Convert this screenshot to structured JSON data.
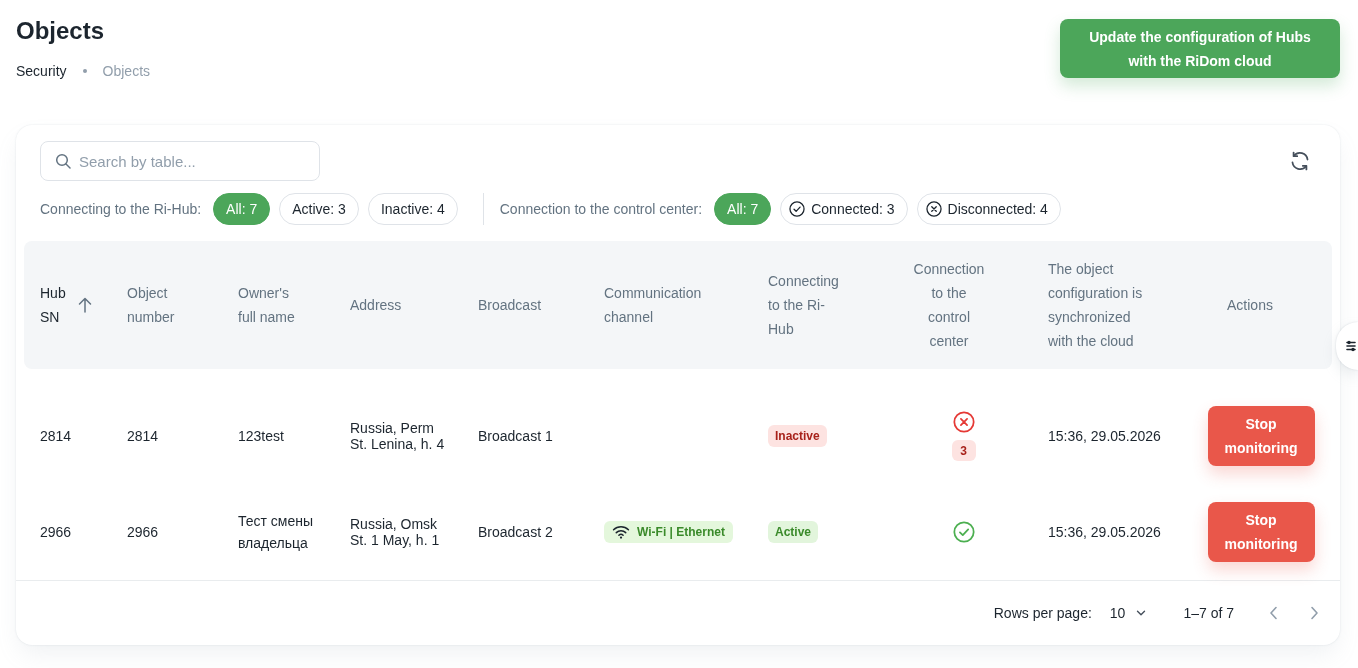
{
  "page": {
    "title": "Objects",
    "breadcrumbs": [
      {
        "label": "Security",
        "current": false
      },
      {
        "label": "Objects",
        "current": true
      }
    ],
    "update_button": "Update the configuration of Hubs with the RiDom cloud"
  },
  "search": {
    "placeholder": "Search by table..."
  },
  "filters": [
    {
      "label": "Connecting to the Ri-Hub:",
      "chips": [
        {
          "label": "All: 7",
          "kind": "all",
          "selected": true
        },
        {
          "label": "Active: 3",
          "kind": "active",
          "selected": false
        },
        {
          "label": "Inactive: 4",
          "kind": "inactive",
          "selected": false
        }
      ]
    },
    {
      "label": "Connection to the control center:",
      "chips": [
        {
          "label": "All: 7",
          "kind": "all",
          "selected": true
        },
        {
          "label": "Connected: 3",
          "kind": "connected",
          "selected": false
        },
        {
          "label": "Disconnected: 4",
          "kind": "disconnected",
          "selected": false
        }
      ]
    }
  ],
  "table": {
    "columns": [
      {
        "label": "Hub SN",
        "sorted": true
      },
      {
        "label": "Object number",
        "sorted": false
      },
      {
        "label": "Owner's full name",
        "sorted": false
      },
      {
        "label": "Address",
        "sorted": false
      },
      {
        "label": "Broadcast",
        "sorted": false
      },
      {
        "label": "Communication channel",
        "sorted": false
      },
      {
        "label": "Connecting to the Ri-Hub",
        "sorted": false
      },
      {
        "label": "Connection to the control center",
        "sorted": false
      },
      {
        "label": "The object configuration is synchronized with the cloud",
        "sorted": false
      },
      {
        "label": "Actions",
        "sorted": false
      }
    ],
    "rows": [
      {
        "hub_sn": "2814",
        "object_number": "2814",
        "owner": "123test",
        "address": [
          "Russia, Perm",
          "St. Lenina, h. 4"
        ],
        "broadcast": "Broadcast 1",
        "hub_status": {
          "label": "Inactive",
          "active": false
        },
        "control_center": {
          "connected": false,
          "count": "3"
        },
        "synced": "15:36, 29.05.2026",
        "action": "Stop monitoring"
      },
      {
        "hub_sn": "2966",
        "object_number": "2966",
        "owner": "Тест смены владельца",
        "address": [
          "Russia, Omsk",
          "St. 1 May, h. 1"
        ],
        "broadcast": "Broadcast 2",
        "channel": "Wi-Fi | Ethernet",
        "hub_status": {
          "label": "Active",
          "active": true
        },
        "control_center": {
          "connected": true
        },
        "synced": "15:36, 29.05.2026",
        "action": "Stop monitoring"
      }
    ]
  },
  "pagination": {
    "rows_per_page_label": "Rows per page:",
    "rows_per_page": "10",
    "range": "1–7 of 7"
  }
}
